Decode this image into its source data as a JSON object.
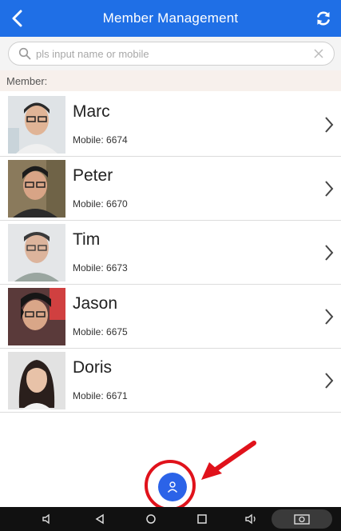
{
  "header": {
    "title": "Member Management"
  },
  "search": {
    "placeholder": "pls input name or mobile"
  },
  "section": {
    "label": "Member:"
  },
  "members": [
    {
      "name": "Marc",
      "mobile": "Mobile: 6674"
    },
    {
      "name": "Peter",
      "mobile": "Mobile: 6670"
    },
    {
      "name": "Tim",
      "mobile": "Mobile: 6673"
    },
    {
      "name": "Jason",
      "mobile": "Mobile: 6675"
    },
    {
      "name": "Doris",
      "mobile": "Mobile: 6671"
    }
  ],
  "colors": {
    "accent": "#1f6fe6",
    "fab": "#2b63e8",
    "annotation": "#e0121b"
  }
}
